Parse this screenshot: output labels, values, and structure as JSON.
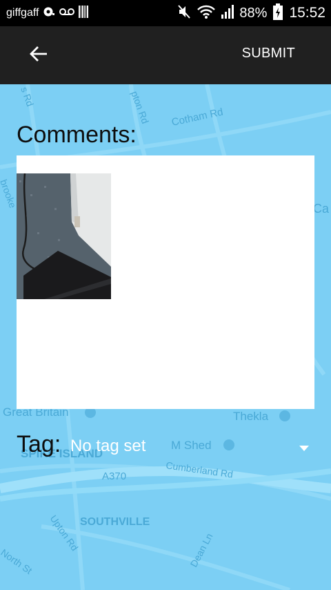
{
  "status_bar": {
    "carrier": "giffgaff",
    "battery_percent": "88%",
    "time": "15:52",
    "icons": [
      "chat-bubble-icon",
      "voicemail-icon",
      "barcode-icon",
      "mute-icon",
      "wifi-icon",
      "signal-icon",
      "battery-charging-icon"
    ]
  },
  "action_bar": {
    "back_icon": "arrow-left-icon",
    "submit_label": "SUBMIT"
  },
  "map": {
    "labels": {
      "cotham_rd": "Cotham Rd",
      "great_britain": "Great Britain",
      "thekla": "Thekla",
      "m_shed": "M Shed",
      "spike_island": "SPIKE ISLAND",
      "a370": "A370",
      "cumberland_rd": "Cumberland Rd",
      "southville": "SOUTHVILLE",
      "upton_rd": "Upton Rd",
      "dean_ln": "Dean Ln",
      "north_st": "North St",
      "brooke": "brooke",
      "ca": "Ca",
      "s_rd": "s Rd",
      "pton_rd": "pton Rd"
    }
  },
  "form": {
    "comments_label": "Comments:",
    "comments_value": "",
    "tag_label": "Tag:",
    "tag_value": "No tag set"
  },
  "colors": {
    "map_water": "#7ccff4",
    "action_bar": "#202020",
    "status_bar": "#000000"
  }
}
